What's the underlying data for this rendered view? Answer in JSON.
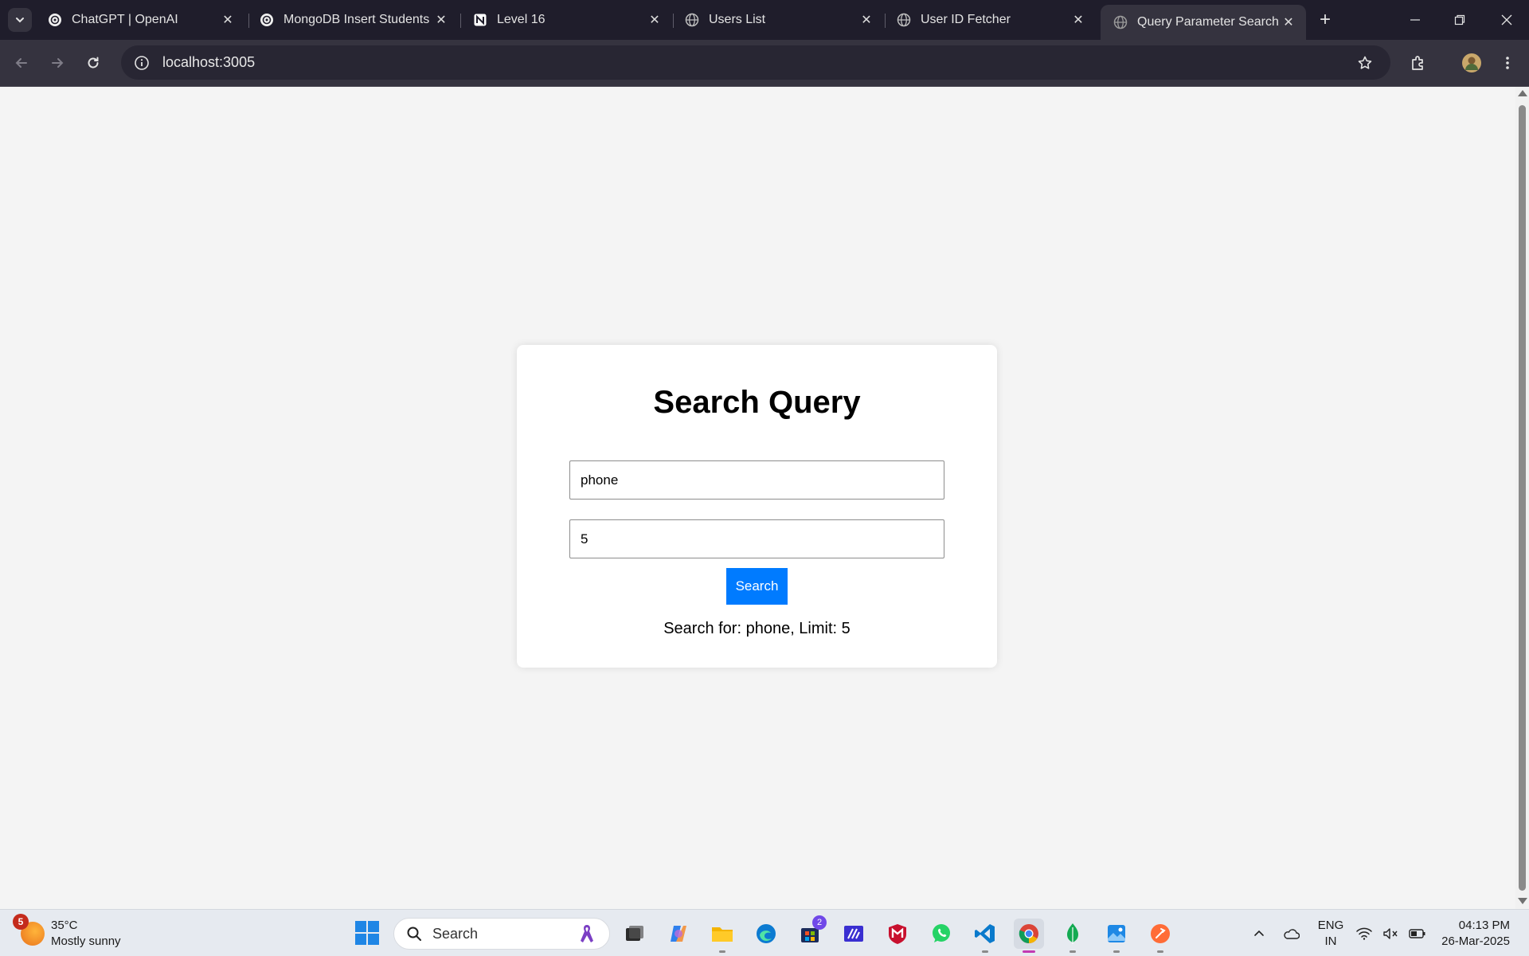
{
  "browser": {
    "tabs": [
      {
        "title": "ChatGPT | OpenAI",
        "icon": "openai-icon"
      },
      {
        "title": "MongoDB Insert Students",
        "icon": "openai-icon"
      },
      {
        "title": "Level 16",
        "icon": "notion-icon"
      },
      {
        "title": "Users List",
        "icon": "globe-icon"
      },
      {
        "title": "User ID Fetcher",
        "icon": "globe-icon"
      },
      {
        "title": "Query Parameter Search",
        "icon": "globe-icon",
        "active": true
      }
    ],
    "url": "localhost:3005"
  },
  "page": {
    "heading": "Search Query",
    "query_value": "phone",
    "limit_value": "5",
    "search_button": "Search",
    "result_text": "Search for: phone, Limit: 5",
    "accent_color": "#007bff"
  },
  "taskbar": {
    "weather": {
      "temp": "35°C",
      "desc": "Mostly sunny",
      "badge": "5"
    },
    "search_placeholder": "Search",
    "store_badge": "2",
    "language": {
      "line1": "ENG",
      "line2": "IN"
    },
    "time": "04:13 PM",
    "date": "26-Mar-2025"
  }
}
